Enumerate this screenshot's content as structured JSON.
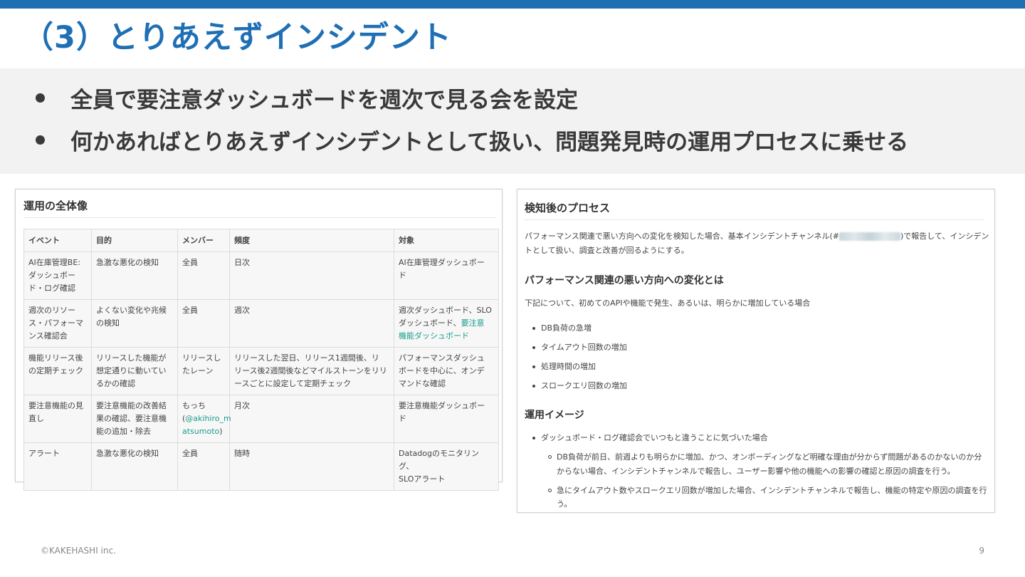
{
  "slide": {
    "title": "（3）とりあえずインシデント",
    "bullets": [
      "全員で要注意ダッシュボードを週次で見る会を設定",
      "何かあればとりあえずインシデントとして扱い、問題発見時の運用プロセスに乗せる"
    ],
    "footer_left": "©KAKEHASHI inc.",
    "page_number": "9"
  },
  "left_panel": {
    "heading": "運用の全体像",
    "columns": [
      "イベント",
      "目的",
      "メンバー",
      "頻度",
      "対象"
    ],
    "rows": [
      {
        "event": [
          "AI在庫管理BE:",
          "ダッシュボー",
          "ド・ログ確認"
        ],
        "purpose": [
          "急激な悪化の検知"
        ],
        "member": [
          "全員"
        ],
        "frequency": [
          "日次"
        ],
        "target": [
          "AI在庫管理ダッシュボー",
          "ド"
        ]
      },
      {
        "event": [
          "週次のリソー",
          "ス・パフォーマ",
          "ンス確認会"
        ],
        "purpose": [
          "よくない変化や兆候",
          "の検知"
        ],
        "member": [
          "全員"
        ],
        "frequency": [
          "週次"
        ],
        "target": [
          "週次ダッシュボード、SLO",
          "ダッシュボード、"
        ],
        "target_link": [
          "要注意",
          "機能ダッシュボード"
        ]
      },
      {
        "event": [
          "機能リリース後",
          "の定期チェック"
        ],
        "purpose": [
          "リリースした機能が",
          "想定通りに動いてい",
          "るかの確認"
        ],
        "member": [
          "リリースし",
          "たレーン"
        ],
        "frequency": [
          "リリースした翌日、リリース1週間後、リ",
          "リース後2週間後などマイルストーンをリリ",
          "ースごとに設定して定期チェック"
        ],
        "target": [
          "パフォーマンスダッシュ",
          "ボードを中心に、オンデ",
          "マンドな確認"
        ]
      },
      {
        "event": [
          "要注意機能の見",
          "直し"
        ],
        "purpose": [
          "要注意機能の改善結",
          "果の確認、要注意機",
          "能の追加・除去"
        ],
        "member": [
          "もっち("
        ],
        "member_link": [
          "@akihiro_m",
          "atsumoto"
        ],
        "member_tail": ")",
        "frequency": [
          "月次"
        ],
        "target": [
          "要注意機能ダッシュボー",
          "ド"
        ]
      },
      {
        "event": [
          "アラート"
        ],
        "purpose": [
          "急激な悪化の検知"
        ],
        "member": [
          "全員"
        ],
        "frequency": [
          "随時"
        ],
        "target": [
          "Datadogのモニタリング、",
          "SLOアラート"
        ]
      }
    ]
  },
  "right_panel": {
    "heading": "検知後のプロセス",
    "intro_line1_a": "パフォーマンス関連で悪い方向への変化を検知した場合、基本インシデントチャンネル(#",
    "intro_line1_b": ")で報告して、インシデン",
    "intro_line2": "トとして扱い、調査と改善が回るようにする。",
    "sub1": "パフォーマンス関連の悪い方向への変化とは",
    "sub1_text": "下記について、初めてのAPIや機能で発生、あるいは、明らかに増加している場合",
    "changes": [
      "DB負荷の急増",
      "タイムアウト回数の増加",
      "処理時間の増加",
      "スロークエリ回数の増加"
    ],
    "sub2": "運用イメージ",
    "usage_item": "ダッシュボード・ログ確認会でいつもと違うことに気づいた場合",
    "usage_sub1_line1": "DB負荷が前日、前週よりも明らかに増加、かつ、オンボーディングなど明確な理由が分からず問題があるのかないのか分",
    "usage_sub1_line2": "からない場合、インシデントチャンネルで報告し、ユーザー影響や他の機能への影響の確認と原因の調査を行う。",
    "usage_sub2_line1": "急にタイムアウト数やスロークエリ回数が増加した場合、インシデントチャンネルで報告し、機能の特定や原因の調査を行",
    "usage_sub2_line2": "う。"
  }
}
